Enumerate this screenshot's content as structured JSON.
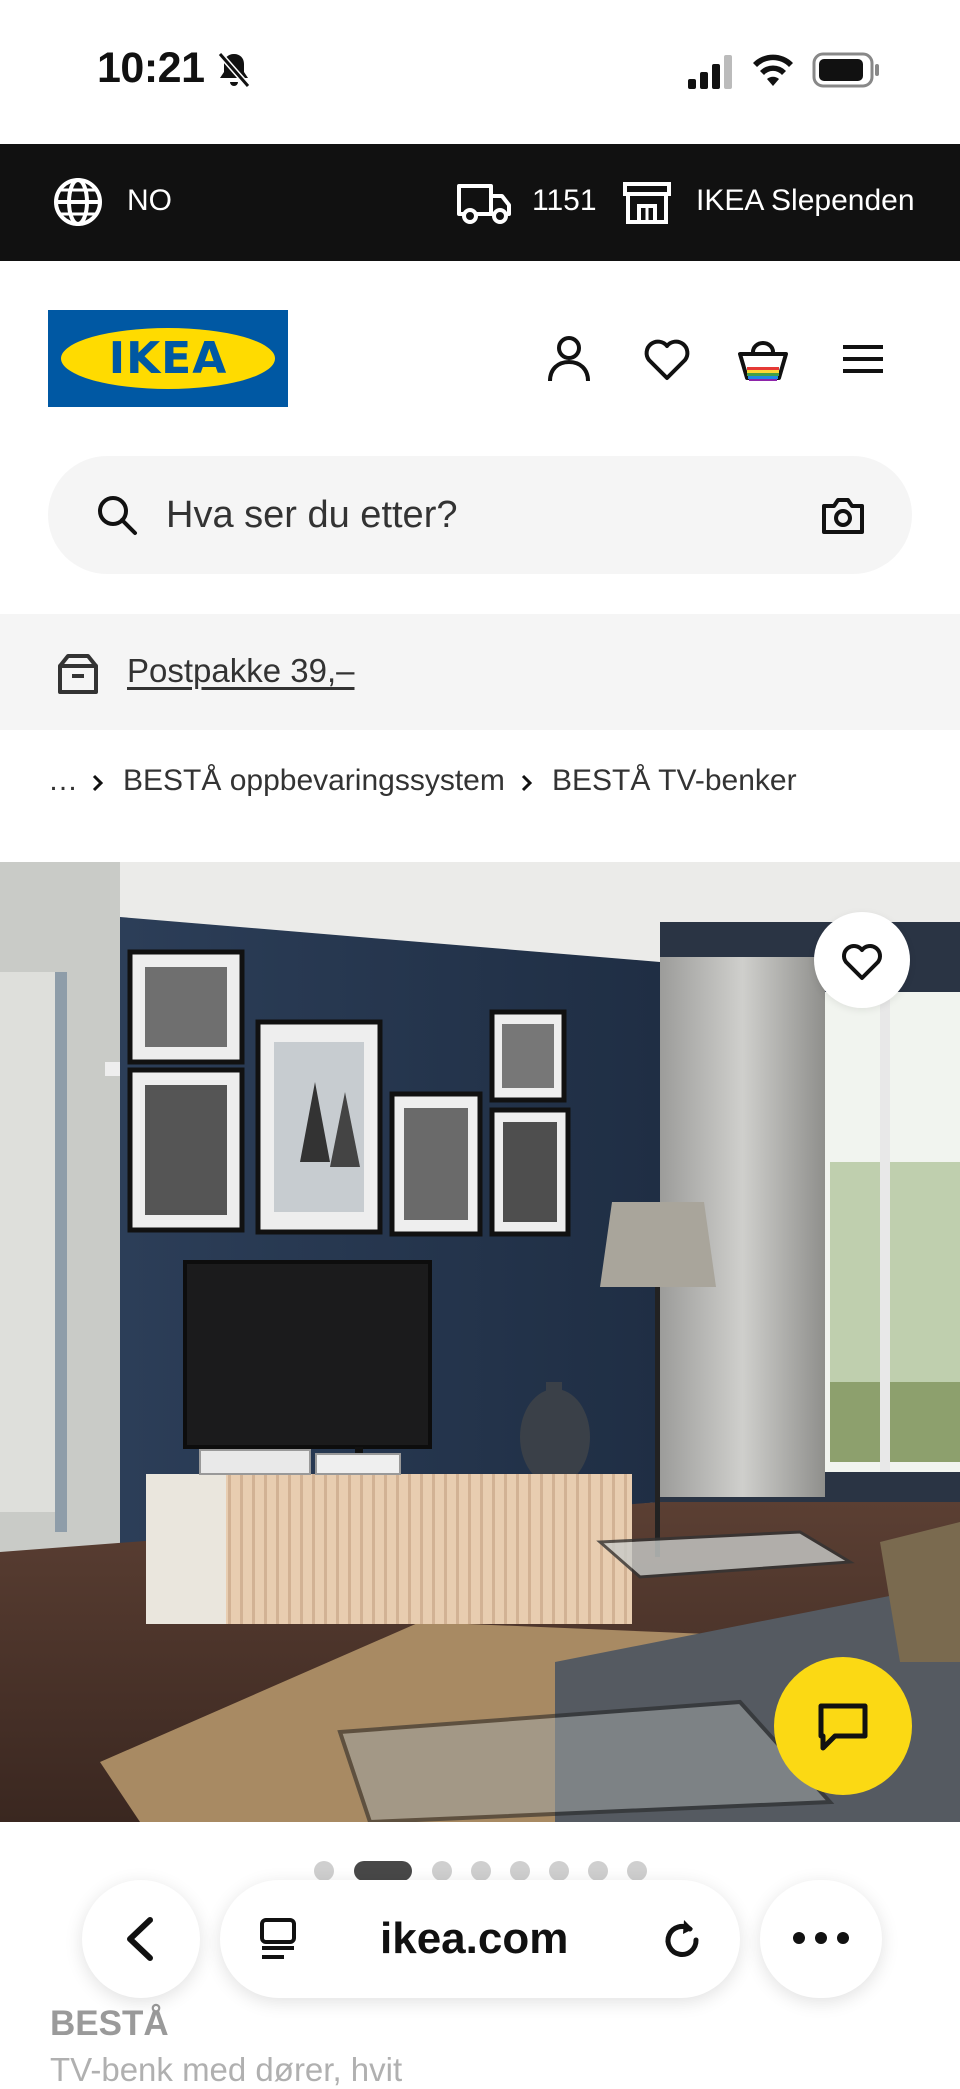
{
  "status_bar": {
    "time": "10:21"
  },
  "top_bar": {
    "language": "NO",
    "postcode": "1151",
    "store": "IKEA Slependen"
  },
  "header": {
    "logo_text": "IKEA",
    "search_placeholder": "Hva ser du etter?"
  },
  "promo": {
    "postpakke": "Postpakke 39,–"
  },
  "breadcrumb": {
    "ellipsis": "…",
    "items": [
      "BESTÅ oppbevaringssystem",
      "BESTÅ TV-benker"
    ]
  },
  "gallery": {
    "image_count": 8,
    "active_index": 1
  },
  "browser": {
    "url": "ikea.com"
  },
  "product": {
    "name": "BESTÅ",
    "description": "TV-benk med dører, hvit"
  },
  "colors": {
    "ikea_blue": "#0058a3",
    "ikea_yellow": "#ffdb00",
    "chat_yellow": "#fbd914",
    "top_bar": "#111111"
  }
}
